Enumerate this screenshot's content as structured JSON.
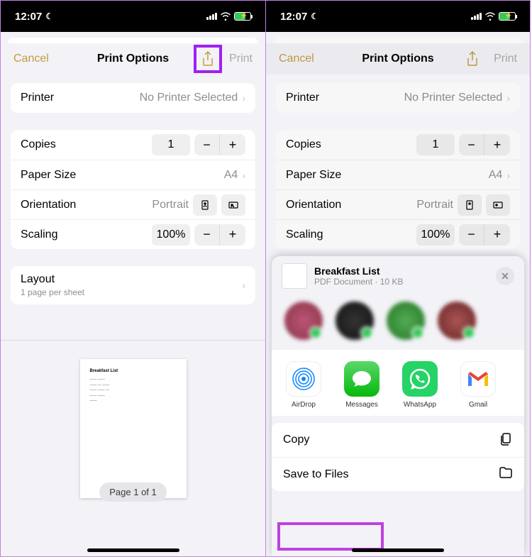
{
  "status": {
    "time": "12:07"
  },
  "nav": {
    "cancel": "Cancel",
    "title": "Print Options",
    "print": "Print"
  },
  "printer": {
    "label": "Printer",
    "value": "No Printer Selected"
  },
  "copies": {
    "label": "Copies",
    "value": "1"
  },
  "paper": {
    "label": "Paper Size",
    "value": "A4"
  },
  "orient": {
    "label": "Orientation",
    "value": "Portrait"
  },
  "scaling": {
    "label": "Scaling",
    "value": "100%"
  },
  "layout": {
    "label": "Layout",
    "sub": "1 page per sheet"
  },
  "preview": {
    "doc_title": "Breakfast List",
    "indicator": "Page 1 of 1"
  },
  "share": {
    "title": "Breakfast List",
    "subtitle": "PDF Document · 10 KB",
    "apps": {
      "airdrop": "AirDrop",
      "messages": "Messages",
      "whatsapp": "WhatsApp",
      "gmail": "Gmail"
    },
    "actions": {
      "copy": "Copy",
      "save": "Save to Files"
    }
  }
}
